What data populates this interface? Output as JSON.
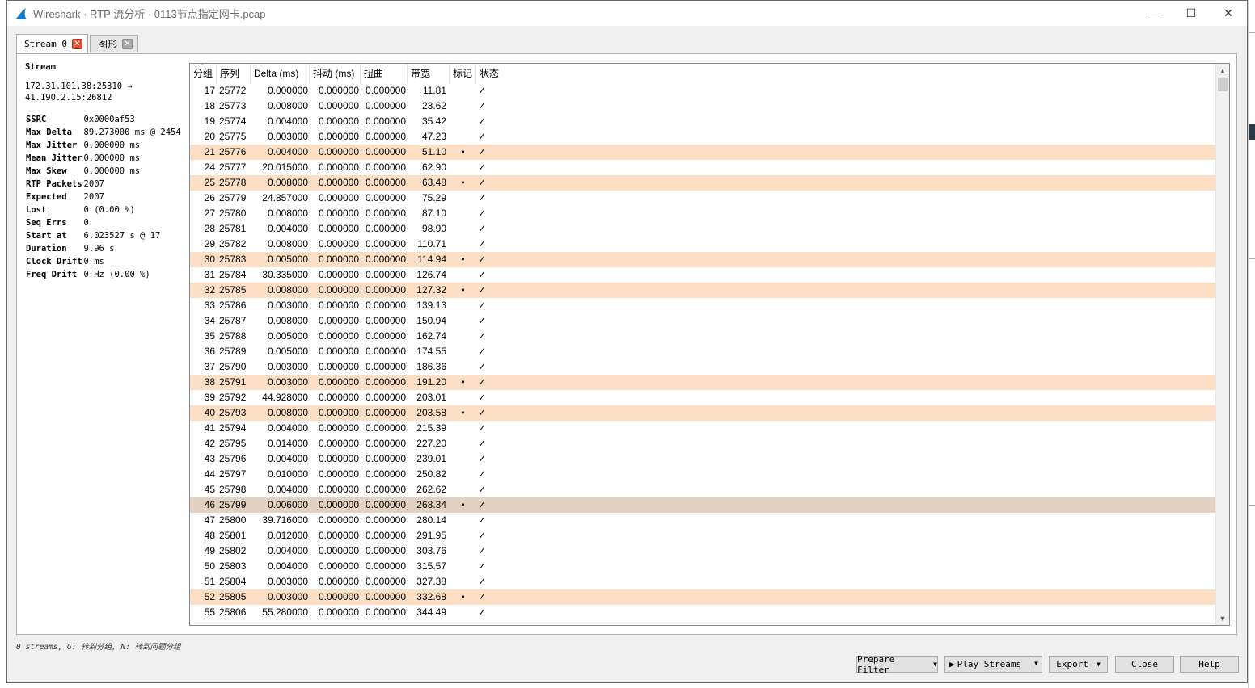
{
  "window": {
    "title": "Wireshark · RTP 流分析 · 0113节点指定网卡.pcap",
    "minimize": "—",
    "maximize": "☐",
    "close": "✕"
  },
  "tabs": [
    {
      "label": "Stream 0",
      "close": "✕"
    },
    {
      "label": "图形",
      "close": "✕"
    }
  ],
  "stats": {
    "heading": "Stream",
    "address_line1": "172.31.101.38:25310 →",
    "address_line2": "41.190.2.15:26812",
    "rows": [
      {
        "key": "SSRC",
        "value": "0x0000af53"
      },
      {
        "key": "Max Delta",
        "value": "89.273000 ms @ 2454"
      },
      {
        "key": "Max Jitter",
        "value": "0.000000 ms"
      },
      {
        "key": "Mean Jitter",
        "value": "0.000000 ms"
      },
      {
        "key": "Max Skew",
        "value": "0.000000 ms"
      },
      {
        "key": "RTP Packets",
        "value": "2007"
      },
      {
        "key": "Expected",
        "value": "2007"
      },
      {
        "key": "Lost",
        "value": "0 (0.00 %)"
      },
      {
        "key": "Seq Errs",
        "value": "0"
      },
      {
        "key": "Start at",
        "value": "6.023527 s @ 17"
      },
      {
        "key": "Duration",
        "value": "9.96 s"
      },
      {
        "key": "Clock Drift",
        "value": "0 ms"
      },
      {
        "key": "Freq Drift",
        "value": "0 Hz (0.00 %)"
      }
    ]
  },
  "table": {
    "columns": [
      "分组",
      "序列",
      "Delta (ms)",
      "抖动 (ms)",
      "扭曲",
      "带宽",
      "标记",
      "状态"
    ],
    "rows": [
      {
        "pkt": "17",
        "seq": "25772",
        "delta": "0.000000",
        "jitter": "0.000000",
        "skew": "0.000000",
        "bw": "11.81",
        "mark": "",
        "status": "✓",
        "style": ""
      },
      {
        "pkt": "18",
        "seq": "25773",
        "delta": "0.008000",
        "jitter": "0.000000",
        "skew": "0.000000",
        "bw": "23.62",
        "mark": "",
        "status": "✓",
        "style": ""
      },
      {
        "pkt": "19",
        "seq": "25774",
        "delta": "0.004000",
        "jitter": "0.000000",
        "skew": "0.000000",
        "bw": "35.42",
        "mark": "",
        "status": "✓",
        "style": ""
      },
      {
        "pkt": "20",
        "seq": "25775",
        "delta": "0.003000",
        "jitter": "0.000000",
        "skew": "0.000000",
        "bw": "47.23",
        "mark": "",
        "status": "✓",
        "style": ""
      },
      {
        "pkt": "21",
        "seq": "25776",
        "delta": "0.004000",
        "jitter": "0.000000",
        "skew": "0.000000",
        "bw": "51.10",
        "mark": "•",
        "status": "✓",
        "style": "marked"
      },
      {
        "pkt": "24",
        "seq": "25777",
        "delta": "20.015000",
        "jitter": "0.000000",
        "skew": "0.000000",
        "bw": "62.90",
        "mark": "",
        "status": "✓",
        "style": ""
      },
      {
        "pkt": "25",
        "seq": "25778",
        "delta": "0.008000",
        "jitter": "0.000000",
        "skew": "0.000000",
        "bw": "63.48",
        "mark": "•",
        "status": "✓",
        "style": "marked"
      },
      {
        "pkt": "26",
        "seq": "25779",
        "delta": "24.857000",
        "jitter": "0.000000",
        "skew": "0.000000",
        "bw": "75.29",
        "mark": "",
        "status": "✓",
        "style": ""
      },
      {
        "pkt": "27",
        "seq": "25780",
        "delta": "0.008000",
        "jitter": "0.000000",
        "skew": "0.000000",
        "bw": "87.10",
        "mark": "",
        "status": "✓",
        "style": ""
      },
      {
        "pkt": "28",
        "seq": "25781",
        "delta": "0.004000",
        "jitter": "0.000000",
        "skew": "0.000000",
        "bw": "98.90",
        "mark": "",
        "status": "✓",
        "style": ""
      },
      {
        "pkt": "29",
        "seq": "25782",
        "delta": "0.008000",
        "jitter": "0.000000",
        "skew": "0.000000",
        "bw": "110.71",
        "mark": "",
        "status": "✓",
        "style": ""
      },
      {
        "pkt": "30",
        "seq": "25783",
        "delta": "0.005000",
        "jitter": "0.000000",
        "skew": "0.000000",
        "bw": "114.94",
        "mark": "•",
        "status": "✓",
        "style": "marked"
      },
      {
        "pkt": "31",
        "seq": "25784",
        "delta": "30.335000",
        "jitter": "0.000000",
        "skew": "0.000000",
        "bw": "126.74",
        "mark": "",
        "status": "✓",
        "style": ""
      },
      {
        "pkt": "32",
        "seq": "25785",
        "delta": "0.008000",
        "jitter": "0.000000",
        "skew": "0.000000",
        "bw": "127.32",
        "mark": "•",
        "status": "✓",
        "style": "marked"
      },
      {
        "pkt": "33",
        "seq": "25786",
        "delta": "0.003000",
        "jitter": "0.000000",
        "skew": "0.000000",
        "bw": "139.13",
        "mark": "",
        "status": "✓",
        "style": ""
      },
      {
        "pkt": "34",
        "seq": "25787",
        "delta": "0.008000",
        "jitter": "0.000000",
        "skew": "0.000000",
        "bw": "150.94",
        "mark": "",
        "status": "✓",
        "style": ""
      },
      {
        "pkt": "35",
        "seq": "25788",
        "delta": "0.005000",
        "jitter": "0.000000",
        "skew": "0.000000",
        "bw": "162.74",
        "mark": "",
        "status": "✓",
        "style": ""
      },
      {
        "pkt": "36",
        "seq": "25789",
        "delta": "0.005000",
        "jitter": "0.000000",
        "skew": "0.000000",
        "bw": "174.55",
        "mark": "",
        "status": "✓",
        "style": ""
      },
      {
        "pkt": "37",
        "seq": "25790",
        "delta": "0.003000",
        "jitter": "0.000000",
        "skew": "0.000000",
        "bw": "186.36",
        "mark": "",
        "status": "✓",
        "style": ""
      },
      {
        "pkt": "38",
        "seq": "25791",
        "delta": "0.003000",
        "jitter": "0.000000",
        "skew": "0.000000",
        "bw": "191.20",
        "mark": "•",
        "status": "✓",
        "style": "marked"
      },
      {
        "pkt": "39",
        "seq": "25792",
        "delta": "44.928000",
        "jitter": "0.000000",
        "skew": "0.000000",
        "bw": "203.01",
        "mark": "",
        "status": "✓",
        "style": ""
      },
      {
        "pkt": "40",
        "seq": "25793",
        "delta": "0.008000",
        "jitter": "0.000000",
        "skew": "0.000000",
        "bw": "203.58",
        "mark": "•",
        "status": "✓",
        "style": "marked"
      },
      {
        "pkt": "41",
        "seq": "25794",
        "delta": "0.004000",
        "jitter": "0.000000",
        "skew": "0.000000",
        "bw": "215.39",
        "mark": "",
        "status": "✓",
        "style": ""
      },
      {
        "pkt": "42",
        "seq": "25795",
        "delta": "0.014000",
        "jitter": "0.000000",
        "skew": "0.000000",
        "bw": "227.20",
        "mark": "",
        "status": "✓",
        "style": ""
      },
      {
        "pkt": "43",
        "seq": "25796",
        "delta": "0.004000",
        "jitter": "0.000000",
        "skew": "0.000000",
        "bw": "239.01",
        "mark": "",
        "status": "✓",
        "style": ""
      },
      {
        "pkt": "44",
        "seq": "25797",
        "delta": "0.010000",
        "jitter": "0.000000",
        "skew": "0.000000",
        "bw": "250.82",
        "mark": "",
        "status": "✓",
        "style": ""
      },
      {
        "pkt": "45",
        "seq": "25798",
        "delta": "0.004000",
        "jitter": "0.000000",
        "skew": "0.000000",
        "bw": "262.62",
        "mark": "",
        "status": "✓",
        "style": ""
      },
      {
        "pkt": "46",
        "seq": "25799",
        "delta": "0.006000",
        "jitter": "0.000000",
        "skew": "0.000000",
        "bw": "268.34",
        "mark": "•",
        "status": "✓",
        "style": "selected"
      },
      {
        "pkt": "47",
        "seq": "25800",
        "delta": "39.716000",
        "jitter": "0.000000",
        "skew": "0.000000",
        "bw": "280.14",
        "mark": "",
        "status": "✓",
        "style": ""
      },
      {
        "pkt": "48",
        "seq": "25801",
        "delta": "0.012000",
        "jitter": "0.000000",
        "skew": "0.000000",
        "bw": "291.95",
        "mark": "",
        "status": "✓",
        "style": ""
      },
      {
        "pkt": "49",
        "seq": "25802",
        "delta": "0.004000",
        "jitter": "0.000000",
        "skew": "0.000000",
        "bw": "303.76",
        "mark": "",
        "status": "✓",
        "style": ""
      },
      {
        "pkt": "50",
        "seq": "25803",
        "delta": "0.004000",
        "jitter": "0.000000",
        "skew": "0.000000",
        "bw": "315.57",
        "mark": "",
        "status": "✓",
        "style": ""
      },
      {
        "pkt": "51",
        "seq": "25804",
        "delta": "0.003000",
        "jitter": "0.000000",
        "skew": "0.000000",
        "bw": "327.38",
        "mark": "",
        "status": "✓",
        "style": ""
      },
      {
        "pkt": "52",
        "seq": "25805",
        "delta": "0.003000",
        "jitter": "0.000000",
        "skew": "0.000000",
        "bw": "332.68",
        "mark": "•",
        "status": "✓",
        "style": "marked"
      },
      {
        "pkt": "55",
        "seq": "25806",
        "delta": "55.280000",
        "jitter": "0.000000",
        "skew": "0.000000",
        "bw": "344.49",
        "mark": "",
        "status": "✓",
        "style": ""
      }
    ]
  },
  "hint": "0 streams, G: 转到分组, N: 转到问题分组",
  "buttons": {
    "prepare_filter": "Prepare Filter",
    "play_streams": "Play Streams",
    "export": "Export",
    "close": "Close",
    "help": "Help"
  },
  "colors": {
    "marked_row": "#fddfc5",
    "selected_row": "#e3d2c2",
    "tab_close_active": "#e0533b"
  }
}
